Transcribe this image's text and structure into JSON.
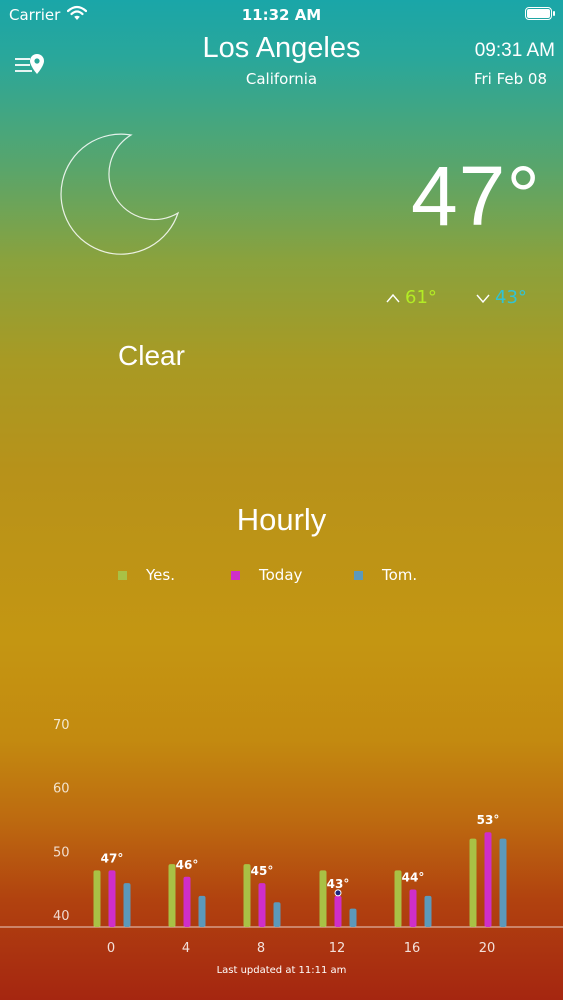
{
  "status_bar": {
    "carrier": "Carrier",
    "time": "11:32 AM"
  },
  "header": {
    "city": "Los Angeles",
    "region": "California",
    "clock": "09:31 AM",
    "date": "Fri Feb 08"
  },
  "current": {
    "temperature": "47°",
    "high": "61°",
    "low": "43°",
    "condition": "Clear",
    "icon": "moon-icon"
  },
  "hourly": {
    "title": "Hourly",
    "legend": [
      {
        "label": "Yes.",
        "color": "#a9c145"
      },
      {
        "label": "Today",
        "color": "#cf2ec9"
      },
      {
        "label": "Tom.",
        "color": "#5c99ba"
      }
    ]
  },
  "chart_data": {
    "type": "bar",
    "categories": [
      "0",
      "4",
      "8",
      "12",
      "16",
      "20"
    ],
    "series": [
      {
        "name": "Yes.",
        "values": [
          47,
          48,
          48,
          47,
          47,
          52
        ]
      },
      {
        "name": "Today",
        "values": [
          47,
          46,
          45,
          43,
          44,
          53
        ]
      },
      {
        "name": "Tom.",
        "values": [
          45,
          43,
          42,
          41,
          43,
          52
        ]
      }
    ],
    "data_labels": [
      "47°",
      "46°",
      "45°",
      "43°",
      "44°",
      "53°"
    ],
    "yticks": [
      "70",
      "60",
      "50",
      "40"
    ],
    "ylim": [
      38,
      72
    ]
  },
  "colors": {
    "high": "#b3ec25",
    "low": "#31c3d6"
  },
  "footer": {
    "updated": "Last updated at 11:11 am"
  }
}
